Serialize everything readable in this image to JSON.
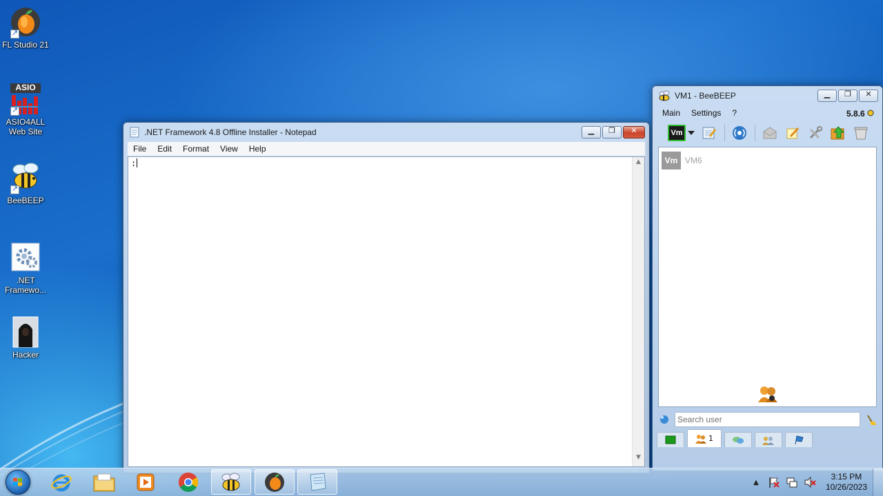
{
  "desktop": {
    "icons": [
      {
        "label": "FL Studio 21"
      },
      {
        "label": "ASIO4ALL\nWeb Site",
        "logo_text": "ASIO"
      },
      {
        "label": "BeeBEEP"
      },
      {
        "label": ".NET\nFramewo..."
      },
      {
        "label": "Hacker"
      }
    ]
  },
  "notepad": {
    "title": ".NET Framework 4.8 Offline Installer - Notepad",
    "menu": [
      "File",
      "Edit",
      "Format",
      "View",
      "Help"
    ],
    "content": ":"
  },
  "beebeep": {
    "title": "VM1 - BeeBEEP",
    "menu": [
      "Main",
      "Settings",
      "?"
    ],
    "version": "5.8.6",
    "profile_badge": "Vm",
    "users": [
      {
        "avatar": "Vm",
        "name": "VM6"
      }
    ],
    "search_placeholder": "Search user",
    "users_tab_count": "1"
  },
  "taskbar": {
    "clock_time": "3:15 PM",
    "clock_date": "10/26/2023"
  },
  "colors": {
    "desktop_blue": "#0f57b8",
    "accent_green": "#2fbf2f",
    "close_red": "#c9442b"
  }
}
